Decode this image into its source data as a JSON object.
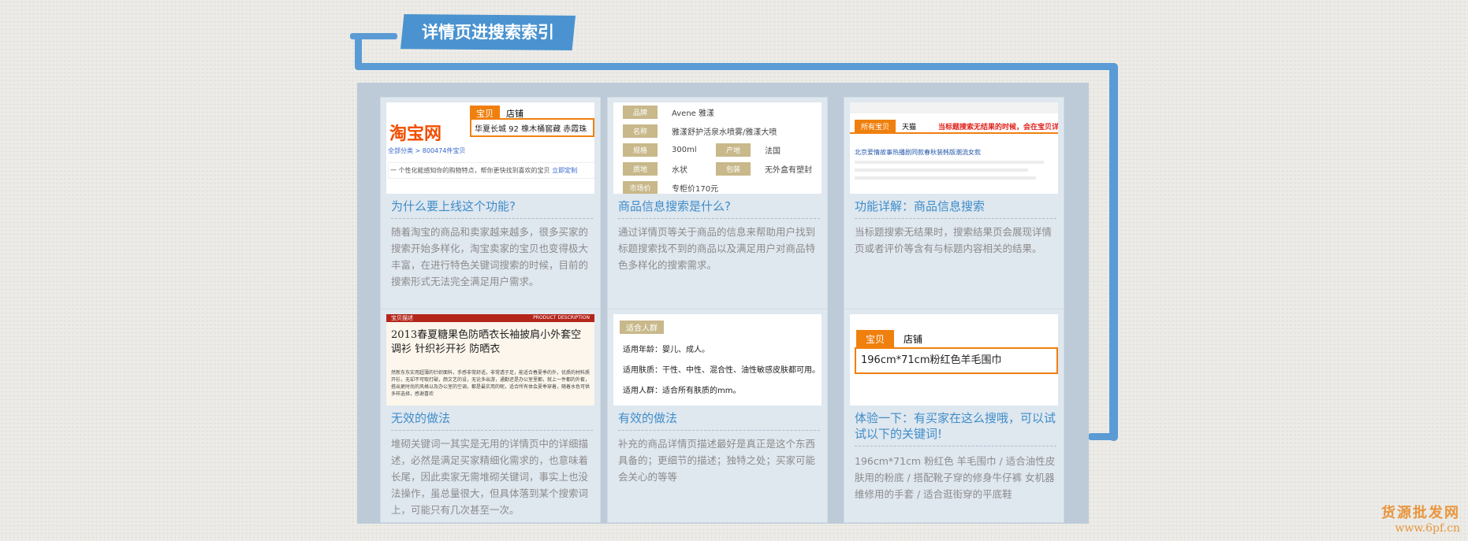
{
  "header": {
    "title": "详情页进搜索索引"
  },
  "cards": [
    {
      "title": "为什么要上线这个功能?",
      "body": "随着淘宝的商品和卖家越来越多，很多买家的搜索开始多样化，淘宝卖家的宝贝也变得极大丰富，在进行特色关键词搜索的时候，目前的搜索形式无法完全满足用户需求。",
      "shot": {
        "logo": "淘宝网",
        "tab_active": "宝贝",
        "tab_other": "店铺",
        "query": "华夏长城 92 橡木桶窖藏 赤霞珠",
        "crumb": "全部分类 > 800474件宝贝",
        "notice": "一 个性化能感知你的购物特点，帮你更快找到喜欢的宝贝",
        "notice_link": "立即定制"
      }
    },
    {
      "title": "商品信息搜索是什么?",
      "body": "通过详情页等关于商品的信息来帮助用户找到标题搜索找不到的商品以及满足用户对商品特色多样化的搜索需求。",
      "shot": {
        "rows": [
          {
            "label": "品牌",
            "value": "Avene 雅漾"
          },
          {
            "label": "名称",
            "value": "雅漾舒护活泉水喷雾/雅漾大喷"
          },
          {
            "label": "规格",
            "value": "300ml",
            "label2": "产地",
            "value2": "法国"
          },
          {
            "label": "质地",
            "value": "水状",
            "label2": "包装",
            "value2": "无外盒有塑封"
          },
          {
            "label": "市场价",
            "value": "专柜价170元"
          }
        ]
      }
    },
    {
      "title": "功能详解：商品信息搜索",
      "body": "当标题搜索无结果时，搜索结果页会展现详情页或者评价等含有与标题内容相关的结果。",
      "shot": {
        "tab_active": "所有宝贝",
        "tab_other": "天猫",
        "alert": "当标题搜索无结果的时候，会在宝贝详",
        "result": "北京爱情故事热播剧同款春秋装韩版潮流女款"
      }
    },
    {
      "title": "无效的做法",
      "body": "堆砌关键词一其实是无用的详情页中的详细描述，必然是满足买家精细化需求的，也意味着长尾，因此卖家无需堆砌关键词，事实上也没法操作，虽总量很大，但具体落到某个搜索词上，可能只有几次甚至一次。",
      "shot": {
        "bar_left": "宝贝描述",
        "bar_right": "PRODUCT DESCRIPTION",
        "headline": "2013春夏糖果色防晒衣长袖披肩小外套空调衫 针织衫开衫 防晒衣",
        "fine": "然新东东实用超薄的针织面料，手感非常舒适，非常透于足，能适合春夏季的外，优质的材料质开衫，无却不可取打破，颜文艺的设，无论多出游，通勤还是办公室里都，就上一件都的外套，搭出更时尚的风格以及办公室的空调，都是最实用的呢，适合所有体会夏季穿着，随着水色可供多样选择，感谢喜欢"
      }
    },
    {
      "title": "有效的做法",
      "body": "补充的商品详情页描述最好是真正是这个东西具备的；更细节的描述；独特之处；买家可能会关心的等等",
      "shot": {
        "tag": "适合人群",
        "lines": [
          "适用年龄：婴儿、成人。",
          "适用肤质：干性、中性、混合性、油性敏感皮肤都可用。",
          "适用人群：适合所有肤质的mm。"
        ]
      }
    },
    {
      "title": "体验一下：有买家在这么搜哦，可以试试以下的关键词!",
      "body": "196cm*71cm 粉红色 羊毛围巾 / 适合油性皮肤用的粉底 / 搭配靴子穿的修身牛仔裤 女机器维修用的手套 / 适合逛街穿的平底鞋",
      "shot": {
        "tab_active": "宝贝",
        "tab_other": "店铺",
        "query": "196cm*71cm粉红色羊毛围巾"
      }
    }
  ],
  "watermark": {
    "line1": "货源批发网",
    "line2": "www.6pf.cn"
  },
  "colors": {
    "accent": "#4a93d0",
    "orange": "#f0800e",
    "panel": "#bccbd7",
    "card": "#dfe7ef"
  }
}
